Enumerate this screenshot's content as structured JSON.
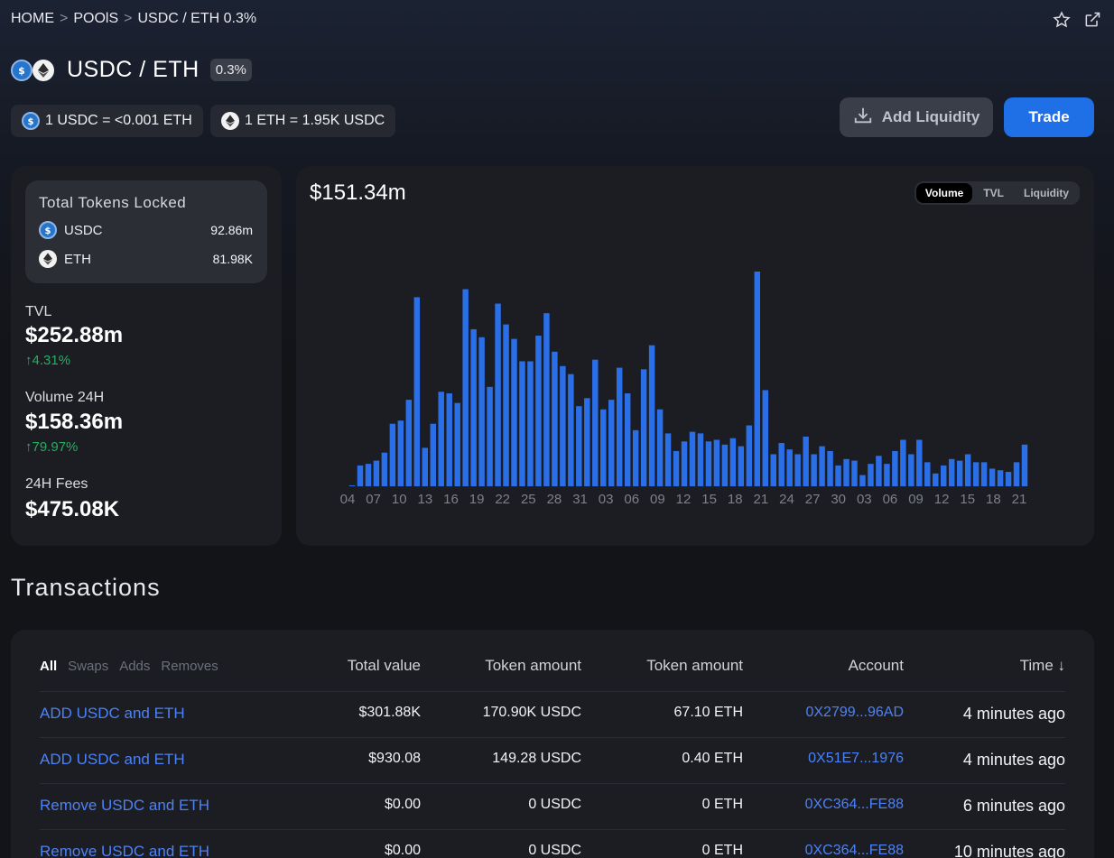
{
  "breadcrumb": {
    "home": "HOME",
    "pools": "POOlS",
    "current": "USDC / ETH 0.3%",
    "sep": ">"
  },
  "pool": {
    "title": "USDC / ETH",
    "fee": "0.3%",
    "rate_usdc": "1 USDC = <0.001 ETH",
    "rate_eth": "1 ETH = 1.95K USDC"
  },
  "buttons": {
    "add_liquidity": "Add Liquidity",
    "trade": "Trade"
  },
  "icons": {
    "star": "star-icon",
    "external": "external-link-icon",
    "download": "download-icon",
    "usdc": "usdc-coin-icon",
    "eth": "eth-coin-icon"
  },
  "stats": {
    "locked_title": "Total Tokens Locked",
    "tokens": [
      {
        "symbol": "USDC",
        "amount": "92.86m"
      },
      {
        "symbol": "ETH",
        "amount": "81.98K"
      }
    ],
    "tvl_label": "TVL",
    "tvl_value": "$252.88m",
    "tvl_change": "↑4.31%",
    "volume_label": "Volume 24H",
    "volume_value": "$158.36m",
    "volume_change": "↑79.97%",
    "fees_label": "24H Fees",
    "fees_value": "$475.08K"
  },
  "chart_header": {
    "value": "$151.34m",
    "tabs": [
      "Volume",
      "TVL",
      "Liquidity"
    ],
    "active_tab": "Volume"
  },
  "colors": {
    "bar": "#2a6fe8",
    "accent": "#1f6fe6",
    "positive": "#27ae60",
    "link": "#4c82f7"
  },
  "chart_data": {
    "type": "bar",
    "x_ticks": [
      "04",
      "07",
      "10",
      "13",
      "16",
      "19",
      "22",
      "25",
      "28",
      "31",
      "03",
      "06",
      "09",
      "12",
      "15",
      "18",
      "21",
      "24",
      "27",
      "30",
      "03",
      "06",
      "09",
      "12",
      "15",
      "18",
      "21"
    ],
    "values": [
      0.5,
      13,
      14,
      16,
      21,
      39,
      41,
      54,
      118,
      24,
      39,
      59,
      58,
      52,
      123,
      98,
      93,
      62,
      114,
      101,
      92,
      78,
      78,
      94,
      108,
      84,
      75,
      70,
      50,
      55,
      79,
      48,
      54,
      74,
      58,
      35,
      73,
      88,
      48,
      33,
      22,
      28,
      34,
      33,
      28,
      29,
      26,
      30,
      25,
      38,
      134,
      60,
      20,
      27,
      23,
      20,
      31,
      20,
      25,
      22,
      13,
      17,
      16,
      7,
      14,
      19,
      14,
      22,
      29,
      20,
      29,
      15,
      8,
      13,
      17,
      16,
      20,
      15,
      15,
      11,
      10,
      9,
      15,
      26
    ],
    "value_unit": "$M (approx)",
    "grid": false
  },
  "transactions": {
    "heading": "Transactions",
    "filters": [
      "All",
      "Swaps",
      "Adds",
      "Removes"
    ],
    "active_filter": "All",
    "columns": [
      "Total value",
      "Token amount",
      "Token amount",
      "Account",
      "Time ↓"
    ],
    "rows": [
      {
        "desc": "ADD USDC and ETH",
        "total": "$301.88K",
        "amt1": "170.90K USDC",
        "amt2": "67.10 ETH",
        "account": "0X2799...96AD",
        "time": "4 minutes ago"
      },
      {
        "desc": "ADD USDC and ETH",
        "total": "$930.08",
        "amt1": "149.28 USDC",
        "amt2": "0.40 ETH",
        "account": "0X51E7...1976",
        "time": "4 minutes ago"
      },
      {
        "desc": "Remove USDC and ETH",
        "total": "$0.00",
        "amt1": "0 USDC",
        "amt2": "0 ETH",
        "account": "0XC364...FE88",
        "time": "6 minutes ago"
      },
      {
        "desc": "Remove USDC and ETH",
        "total": "$0.00",
        "amt1": "0 USDC",
        "amt2": "0 ETH",
        "account": "0XC364...FE88",
        "time": "10 minutes ago"
      }
    ]
  }
}
